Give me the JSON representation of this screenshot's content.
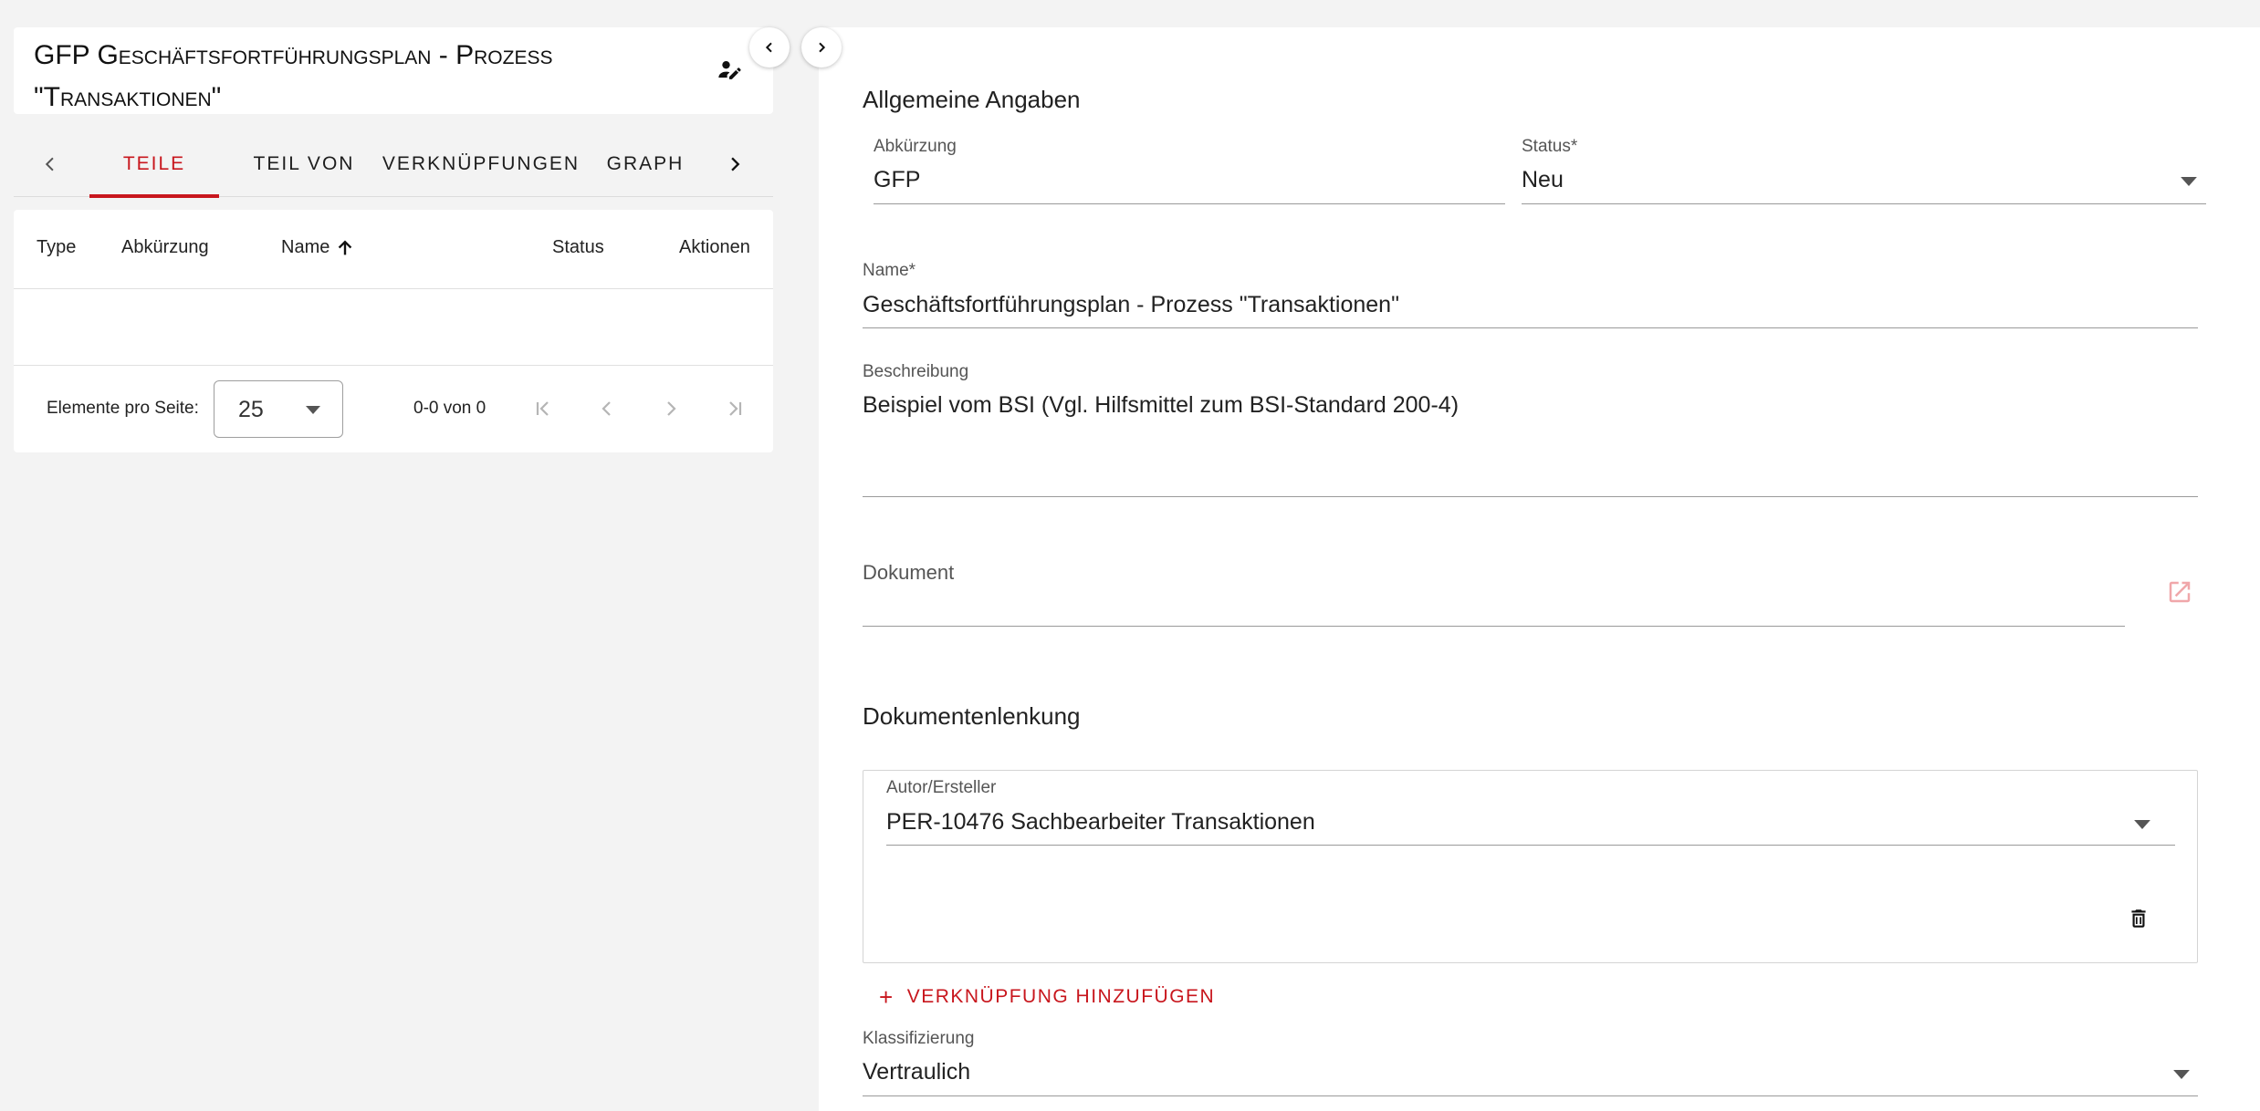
{
  "colors": {
    "accent": "#c8161d",
    "background": "#f3f3f3",
    "panel": "#ffffff"
  },
  "left": {
    "title": "GFP Geschäftsfortführungsplan - Prozess \"Transaktionen\"",
    "title_icon": "edit-person-icon",
    "tabs": [
      {
        "label": "Teile",
        "active": true
      },
      {
        "label": "Teil von",
        "active": false
      },
      {
        "label": "Verknüpfungen",
        "active": false
      },
      {
        "label": "Graph",
        "active": false
      }
    ],
    "table": {
      "columns": [
        "Type",
        "Abkürzung",
        "Name",
        "Status",
        "Aktionen"
      ],
      "sorted_column": "Name",
      "sort_direction": "ascending",
      "rows": []
    },
    "paginator": {
      "per_page_label": "Elemente pro Seite:",
      "per_page_value": "25",
      "range_label": "0-0 von 0"
    }
  },
  "right": {
    "section_general": "Allgemeine Angaben",
    "abbreviation": {
      "label": "Abkürzung",
      "value": "GFP"
    },
    "status": {
      "label": "Status*",
      "value": "Neu"
    },
    "name": {
      "label": "Name*",
      "value": "Geschäftsfortführungsplan - Prozess \"Transaktionen\""
    },
    "description": {
      "label": "Beschreibung",
      "value": "Beispiel vom BSI (Vgl. Hilfsmittel zum BSI-Standard 200-4)"
    },
    "document": {
      "label": "Dokument",
      "value": ""
    },
    "section_doc_control": "Dokumentenlenkung",
    "author": {
      "label": "Autor/Ersteller",
      "value": "PER-10476 Sachbearbeiter Transaktionen"
    },
    "add_link_label": "Verknüpfung hinzufügen",
    "classification": {
      "label": "Klassifizierung",
      "value": "Vertraulich"
    }
  }
}
